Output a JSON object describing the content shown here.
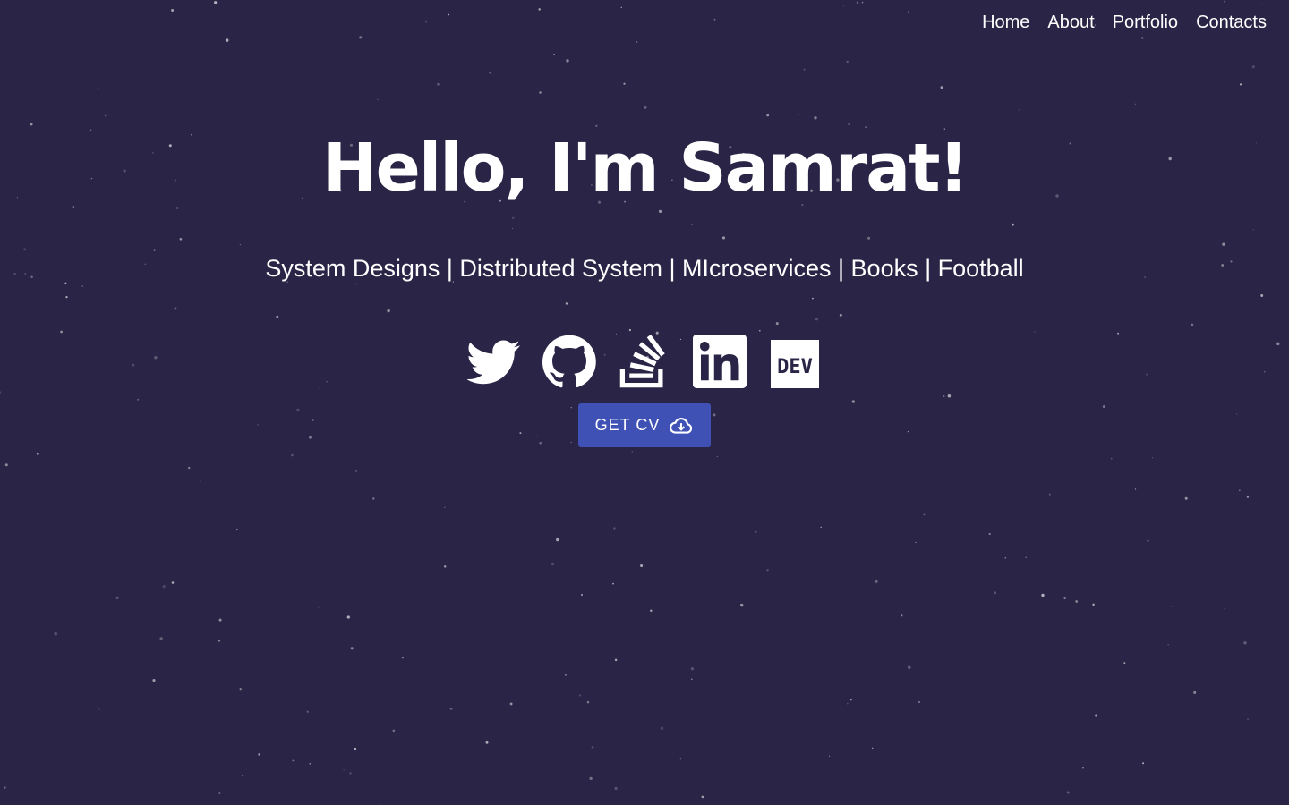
{
  "nav": {
    "items": [
      {
        "label": "Home"
      },
      {
        "label": "About"
      },
      {
        "label": "Portfolio"
      },
      {
        "label": "Contacts"
      }
    ]
  },
  "hero": {
    "title": "Hello, I'm Samrat!",
    "subtitle": "System Designs | Distributed System | MIcroservices | Books | Football"
  },
  "socials": [
    {
      "icon": "twitter-icon"
    },
    {
      "icon": "github-icon"
    },
    {
      "icon": "stackoverflow-icon"
    },
    {
      "icon": "linkedin-icon"
    },
    {
      "icon": "dev-icon",
      "text": "DEV"
    }
  ],
  "cv_button": {
    "label": "GET CV",
    "icon": "cloud-download-icon"
  },
  "colors": {
    "background": "#2a2546",
    "text": "#ffffff",
    "button": "#3f51b5"
  }
}
